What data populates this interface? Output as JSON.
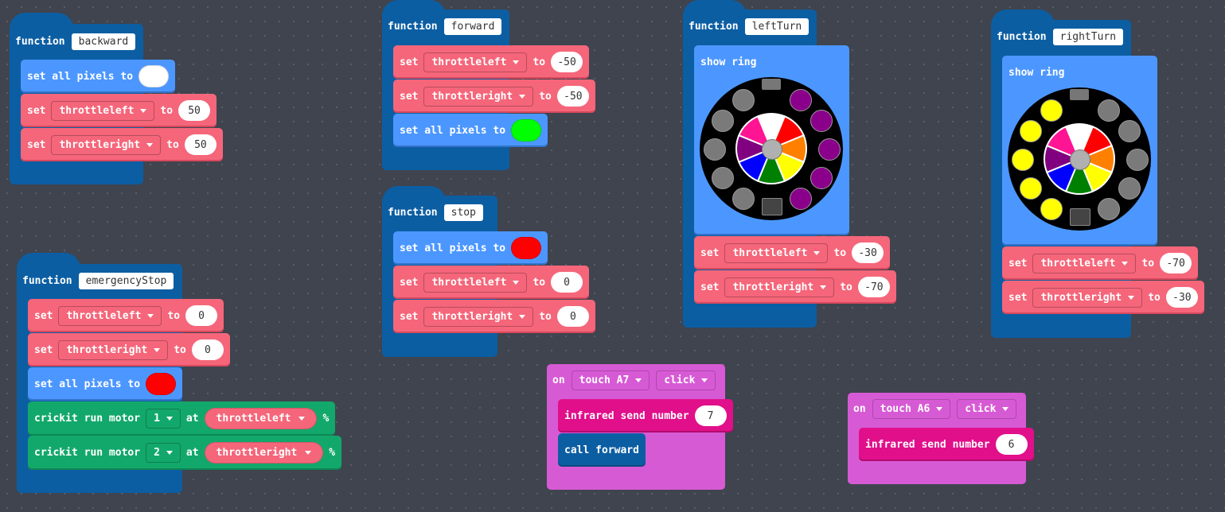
{
  "labels": {
    "function": "function",
    "set": "set",
    "to": "to",
    "set_all_pixels": "set all pixels to",
    "show_ring": "show ring",
    "crickit_run_motor": "crickit run motor",
    "at": "at",
    "percent": "%",
    "on": "on",
    "infrared_send_number": "infrared send number",
    "call": "call forward"
  },
  "colors": {
    "white": "#ffffff",
    "green": "#00ff00",
    "red": "#ff0000"
  },
  "backward": {
    "name": "backward",
    "var1": "throttleleft",
    "val1": "50",
    "var2": "throttleright",
    "val2": "50",
    "pixel_color": "white"
  },
  "forward": {
    "name": "forward",
    "var1": "throttleleft",
    "val1": "-50",
    "var2": "throttleright",
    "val2": "-50",
    "pixel_color": "green"
  },
  "stop": {
    "name": "stop",
    "var1": "throttleleft",
    "val1": "0",
    "var2": "throttleright",
    "val2": "0",
    "pixel_color": "red"
  },
  "leftTurn": {
    "name": "leftTurn",
    "var1": "throttleleft",
    "val1": "-30",
    "var2": "throttleright",
    "val2": "-70",
    "ring_outer": [
      "gray",
      "purple",
      "purple",
      "purple",
      "purple",
      "purple",
      "gray",
      "gray",
      "gray",
      "gray"
    ]
  },
  "rightTurn": {
    "name": "rightTurn",
    "var1": "throttleleft",
    "val1": "-70",
    "var2": "throttleright",
    "val2": "-30",
    "ring_outer": [
      "yellow",
      "gray",
      "gray",
      "gray",
      "gray",
      "gray",
      "yellow",
      "yellow",
      "yellow",
      "yellow"
    ]
  },
  "emergencyStop": {
    "name": "emergencyStop",
    "var1": "throttleleft",
    "val1": "0",
    "var2": "throttleright",
    "val2": "0",
    "pixel_color": "red",
    "motor1": "1",
    "motor1_var": "throttleleft",
    "motor2": "2",
    "motor2_var": "throttleright"
  },
  "event1": {
    "pin": "touch A7",
    "action": "click",
    "number": "7"
  },
  "event2": {
    "pin": "touch A6",
    "action": "click",
    "number": "6"
  }
}
